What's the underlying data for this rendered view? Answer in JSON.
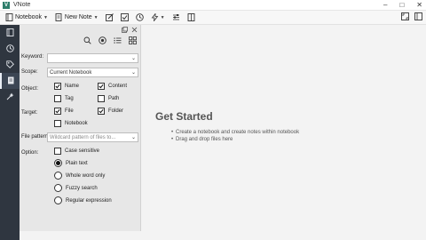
{
  "window": {
    "title": "VNote",
    "controls": [
      "–",
      "□",
      "✕"
    ]
  },
  "toolbar": {
    "notebook_label": "Notebook",
    "new_note_label": "New Note"
  },
  "sidebar": {
    "items": [
      {
        "icon": "notebook-icon",
        "active": false
      },
      {
        "icon": "history-icon",
        "active": false
      },
      {
        "icon": "tag-icon",
        "active": false
      },
      {
        "icon": "search-icon",
        "active": true
      },
      {
        "icon": "snippet-icon",
        "active": false
      }
    ]
  },
  "search_panel": {
    "keyword_label": "Keyword:",
    "keyword_value": "",
    "scope_label": "Scope:",
    "scope_value": "Current Notebook",
    "object_label": "Object:",
    "object_options": [
      {
        "label": "Name",
        "checked": true
      },
      {
        "label": "Content",
        "checked": true
      },
      {
        "label": "Tag",
        "checked": false
      },
      {
        "label": "Path",
        "checked": false
      }
    ],
    "target_label": "Target:",
    "target_options": [
      {
        "label": "File",
        "checked": true
      },
      {
        "label": "Folder",
        "checked": true
      },
      {
        "label": "Notebook",
        "checked": false
      }
    ],
    "file_pattern_label": "File pattern:",
    "file_pattern_placeholder": "Wildcard pattern of files to...",
    "option_label": "Option:",
    "case_sensitive": {
      "label": "Case sensitive",
      "checked": false
    },
    "match_modes": [
      {
        "label": "Plain text",
        "selected": true
      },
      {
        "label": "Whole word only",
        "selected": false
      },
      {
        "label": "Fuzzy search",
        "selected": false
      },
      {
        "label": "Regular expression",
        "selected": false
      }
    ]
  },
  "main": {
    "title": "Get Started",
    "items": [
      "Create a notebook and create notes within notebook",
      "Drag and drop files here"
    ]
  }
}
